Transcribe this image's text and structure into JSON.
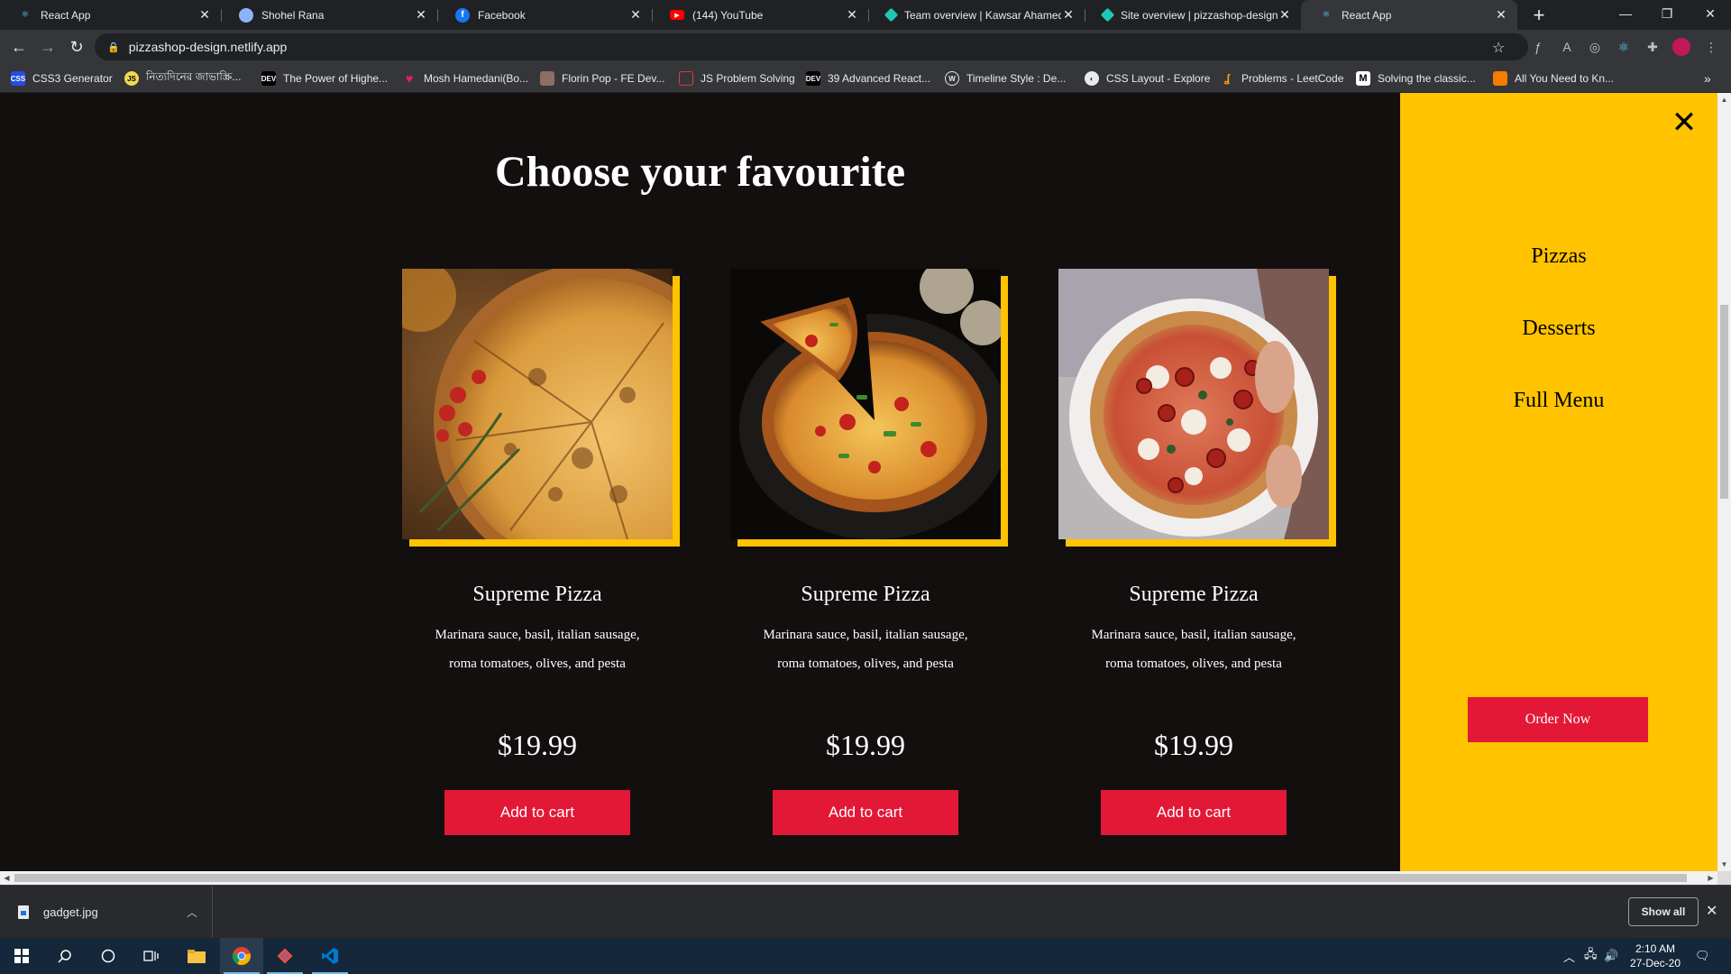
{
  "browser": {
    "tabs": [
      {
        "title": "React App",
        "icon": "react-icon",
        "color": "#61dafb"
      },
      {
        "title": "Shohel Rana",
        "icon": "avatar-icon",
        "color": "#8ab4f8"
      },
      {
        "title": "Facebook",
        "icon": "facebook-icon",
        "color": "#1877f2"
      },
      {
        "title": "(144) YouTube",
        "icon": "youtube-icon",
        "color": "#ff0000"
      },
      {
        "title": "Team overview | Kawsar Ahamed",
        "icon": "netlify-icon",
        "color": "#20c6b7"
      },
      {
        "title": "Site overview | pizzashop-design",
        "icon": "netlify-icon",
        "color": "#20c6b7"
      },
      {
        "title": "React App",
        "icon": "react-icon",
        "color": "#61dafb",
        "active": true
      }
    ],
    "url": "pizzashop-design.netlify.app",
    "bookmarks": [
      {
        "label": "CSS3 Generator",
        "icon": "css3-icon"
      },
      {
        "label": "নিত্যদিনের জাভাস্ক্রি...",
        "icon": "js-icon"
      },
      {
        "label": "The Power of Highe...",
        "icon": "dev-icon"
      },
      {
        "label": "Mosh Hamedani(Bo...",
        "icon": "heart-icon"
      },
      {
        "label": "Florin Pop - FE Dev...",
        "icon": "image-icon"
      },
      {
        "label": "JS Problem Solving",
        "icon": "grid-icon"
      },
      {
        "label": "39 Advanced React...",
        "icon": "dev-icon"
      },
      {
        "label": "Timeline Style : De...",
        "icon": "wordpress-icon"
      },
      {
        "label": "CSS Layout - Explore",
        "icon": "globe-icon"
      },
      {
        "label": "Problems - LeetCode",
        "icon": "leetcode-icon"
      },
      {
        "label": "Solving the classic...",
        "icon": "medium-icon"
      },
      {
        "label": "All You Need to Kn...",
        "icon": "orange-icon"
      }
    ]
  },
  "page": {
    "heading": "Choose your favourite",
    "products": [
      {
        "name": "Supreme Pizza",
        "description": "Marinara sauce, basil, italian sausage, roma tomatoes, olives, and pesta",
        "price": "$19.99",
        "button": "Add to cart"
      },
      {
        "name": "Supreme Pizza",
        "description": "Marinara sauce, basil, italian sausage, roma tomatoes, olives, and pesta",
        "price": "$19.99",
        "button": "Add to cart"
      },
      {
        "name": "Supreme Pizza",
        "description": "Marinara sauce, basil, italian sausage, roma tomatoes, olives, and pesta",
        "price": "$19.99",
        "button": "Add to cart"
      }
    ],
    "menu": {
      "items": [
        "Pizzas",
        "Desserts",
        "Full Menu"
      ],
      "order_button": "Order Now",
      "close_icon": "close-icon"
    },
    "colors": {
      "accent": "#ffc300",
      "button": "#e31837",
      "background": "#130f0f"
    }
  },
  "downloads": {
    "file": "gadget.jpg",
    "show_all": "Show all"
  },
  "taskbar": {
    "time": "2:10 AM",
    "date": "27-Dec-20"
  }
}
